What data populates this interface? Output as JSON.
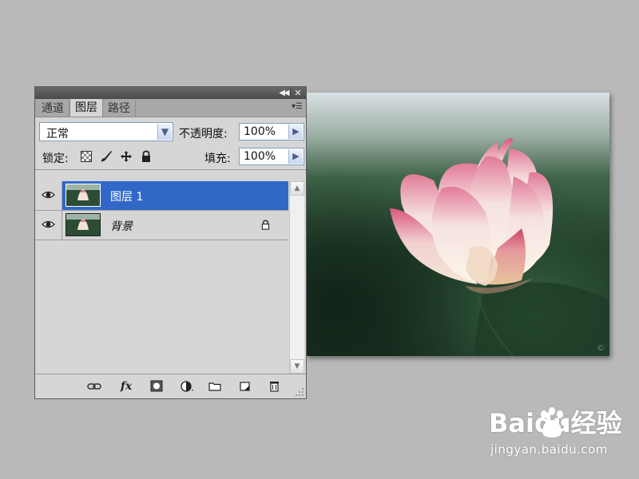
{
  "panel": {
    "tabs": [
      {
        "label": "通道"
      },
      {
        "label": "图层"
      },
      {
        "label": "路径"
      }
    ],
    "blend_mode": "正常",
    "opacity_label": "不透明度:",
    "opacity_value": "100%",
    "lock_label": "锁定:",
    "fill_label": "填充:",
    "fill_value": "100%",
    "layers": [
      {
        "name": "图层 1",
        "selected": true,
        "visible": true,
        "locked": false
      },
      {
        "name": "背景",
        "selected": false,
        "visible": true,
        "locked": true
      }
    ],
    "lock_icons": [
      "lock-transparent-icon",
      "lock-image-icon",
      "lock-position-icon",
      "lock-all-icon"
    ],
    "bottom_icons": [
      "link-icon",
      "fx-icon",
      "mask-icon",
      "adjustment-icon",
      "folder-icon",
      "new-layer-icon",
      "trash-icon"
    ]
  },
  "watermark": {
    "brand": "Baidu经验",
    "url": "jingyan.baidu.com"
  },
  "colors": {
    "selection": "#3168c8",
    "panel_bg": "#d6d6d6",
    "desktop_bg": "#b9b9b9"
  }
}
